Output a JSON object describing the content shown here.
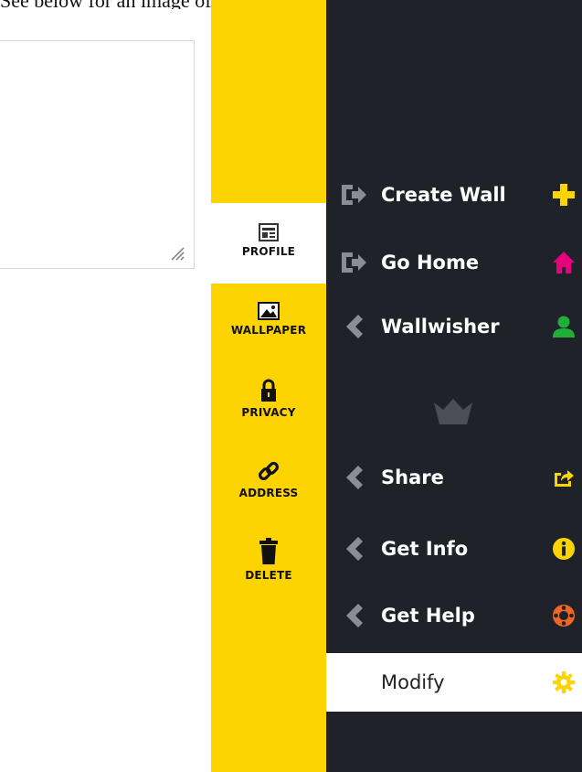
{
  "caption": "See below for an image of the options.",
  "tabs": [
    {
      "id": "profile",
      "label": "PROFILE",
      "icon": "newspaper-icon",
      "active": true
    },
    {
      "id": "wallpaper",
      "label": "WALLPAPER",
      "icon": "image-icon",
      "active": false
    },
    {
      "id": "privacy",
      "label": "PRIVACY",
      "icon": "lock-icon",
      "active": false
    },
    {
      "id": "address",
      "label": "ADDRESS",
      "icon": "link-icon",
      "active": false
    },
    {
      "id": "delete",
      "label": "DELETE",
      "icon": "trash-icon",
      "active": false
    }
  ],
  "menu": [
    {
      "id": "create-wall",
      "label": "Create Wall",
      "lead_icon": "sign-in-icon",
      "trail_icon": "plus-icon",
      "trail_color": "#fed400"
    },
    {
      "id": "go-home",
      "label": "Go Home",
      "lead_icon": "sign-in-icon",
      "trail_icon": "home-icon",
      "trail_color": "#e5007e"
    },
    {
      "id": "wallwisher",
      "label": "Wallwisher",
      "lead_icon": "chevron-left-icon",
      "trail_icon": "user-icon",
      "trail_color": "#1fae3a"
    },
    {
      "id": "share",
      "label": "Share",
      "lead_icon": "chevron-left-icon",
      "trail_icon": "share-icon",
      "trail_color": "#fed400"
    },
    {
      "id": "get-info",
      "label": "Get Info",
      "lead_icon": "chevron-left-icon",
      "trail_icon": "info-icon",
      "trail_color": "#fed400"
    },
    {
      "id": "get-help",
      "label": "Get Help",
      "lead_icon": "chevron-left-icon",
      "trail_icon": "lifebuoy-icon",
      "trail_color": "#f26522"
    },
    {
      "id": "modify",
      "label": "Modify",
      "lead_icon": "",
      "trail_icon": "gear-icon",
      "trail_color": "#fed400"
    }
  ],
  "colors": {
    "yellow": "#fed400",
    "dark": "#1f2228",
    "icon_gray": "#8a8d93"
  }
}
